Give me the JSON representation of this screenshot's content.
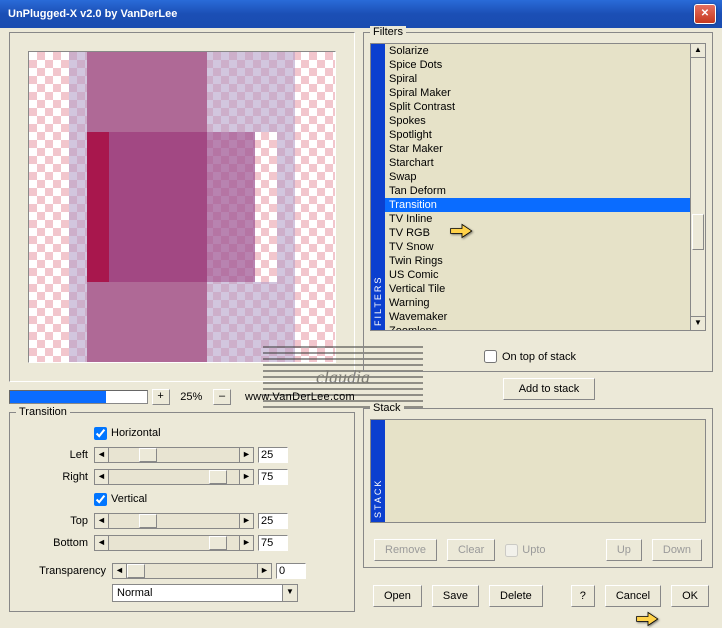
{
  "window": {
    "title": "UnPlugged-X v2.0 by VanDerLee"
  },
  "zoom": {
    "percent": "25%",
    "plus": "+",
    "minus": "–"
  },
  "url": "www.VanDerLee.com",
  "watermark": "claudia",
  "transition": {
    "legend": "Transition",
    "horizontal_label": "Horizontal",
    "vertical_label": "Vertical",
    "left_label": "Left",
    "left_val": "25",
    "right_label": "Right",
    "right_val": "75",
    "top_label": "Top",
    "top_val": "25",
    "bottom_label": "Bottom",
    "bottom_val": "75",
    "transparency_label": "Transparency",
    "transparency_val": "0",
    "mode": "Normal"
  },
  "filters": {
    "legend": "Filters",
    "side_label": "FILTERS",
    "items": [
      "Solarize",
      "Spice Dots",
      "Spiral",
      "Spiral Maker",
      "Split Contrast",
      "Spokes",
      "Spotlight",
      "Star Maker",
      "Starchart",
      "Swap",
      "Tan Deform",
      "Transition",
      "TV Inline",
      "TV RGB",
      "TV Snow",
      "Twin Rings",
      "US Comic",
      "Vertical Tile",
      "Warning",
      "Wavemaker",
      "Zoomlens"
    ],
    "selected": "Transition",
    "ontop_label": "On top of stack"
  },
  "addstack": "Add to stack",
  "stack": {
    "legend": "Stack",
    "side_label": "STACK",
    "remove": "Remove",
    "clear": "Clear",
    "upto": "Upto",
    "up": "Up",
    "down": "Down"
  },
  "buttons": {
    "open": "Open",
    "save": "Save",
    "delete": "Delete",
    "help": "?",
    "cancel": "Cancel",
    "ok": "OK"
  },
  "glyph": {
    "left": "◄",
    "right": "►",
    "up": "▲",
    "down": "▼"
  }
}
